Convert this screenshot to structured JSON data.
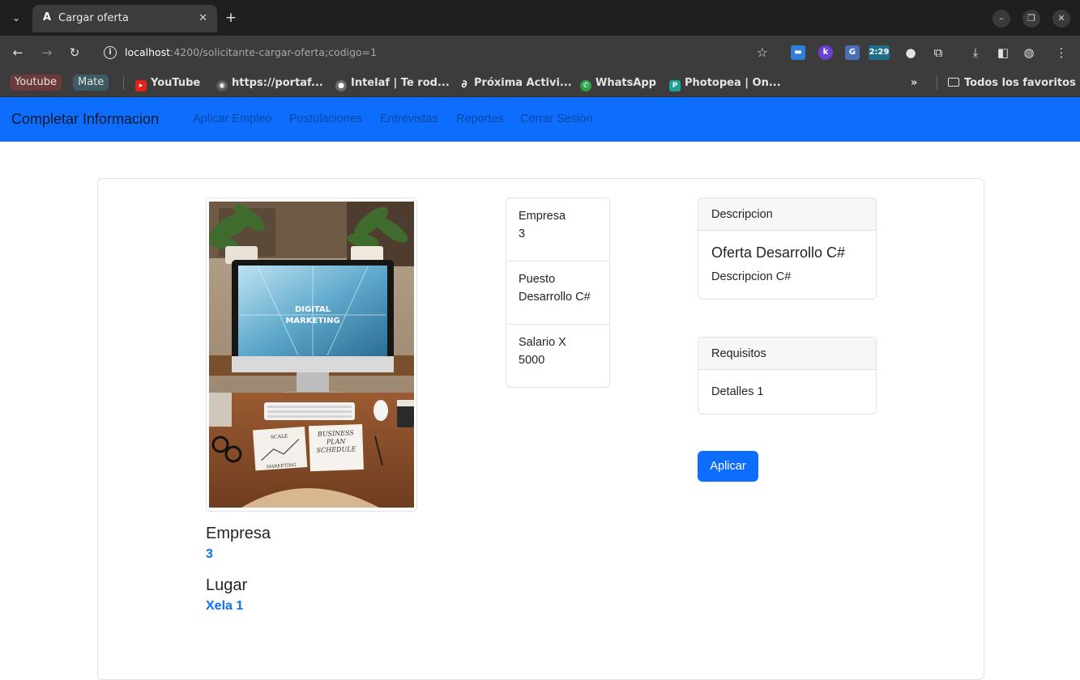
{
  "browser": {
    "tab": {
      "title": "Cargar oferta",
      "favicon": "A"
    },
    "url": {
      "host": "localhost",
      "path": ":4200/solicitante-cargar-oferta;codigo=1"
    },
    "extensions": {
      "clock_badge": "2:29"
    },
    "bookmarks": [
      {
        "label": "Youtube"
      },
      {
        "label": "Mate"
      },
      {
        "label": "YouTube"
      },
      {
        "label": "https://portaf..."
      },
      {
        "label": "Intelaf | Te rod..."
      },
      {
        "label": "Próxima Activi..."
      },
      {
        "label": "WhatsApp"
      },
      {
        "label": "Photopea | On..."
      }
    ],
    "overflow_label": "»",
    "all_bookmarks": "Todos los favoritos"
  },
  "navbar": {
    "brand": "Completar Informacion",
    "links": [
      "Aplicar Empleo",
      "Postulaciones",
      "Entrevistas",
      "Reportes",
      "Cerrar Sesion"
    ]
  },
  "image": {
    "screen_text": "DIGITAL MARKETING",
    "notebook_left": "SCALE",
    "notebook_right": "BUSINESS PLAN SCHEDULE",
    "notebook_bottom": "MARKETING"
  },
  "info": {
    "empresa_label": "Empresa",
    "empresa_value": "3",
    "lugar_label": "Lugar",
    "lugar_value": "Xela 1"
  },
  "details": [
    {
      "label": "Empresa",
      "value": "3"
    },
    {
      "label": "Puesto",
      "value": "Desarrollo C#"
    },
    {
      "label": "Salario X",
      "value": "5000"
    }
  ],
  "descripcion": {
    "header": "Descripcion",
    "title": "Oferta Desarrollo C#",
    "text": "Descripcion C#"
  },
  "requisitos": {
    "header": "Requisitos",
    "text": "Detalles 1"
  },
  "apply_label": "Aplicar",
  "colors": {
    "primary": "#0d6efd",
    "chrome_dark": "#1f1f1f",
    "chrome": "#3c3c3c"
  }
}
